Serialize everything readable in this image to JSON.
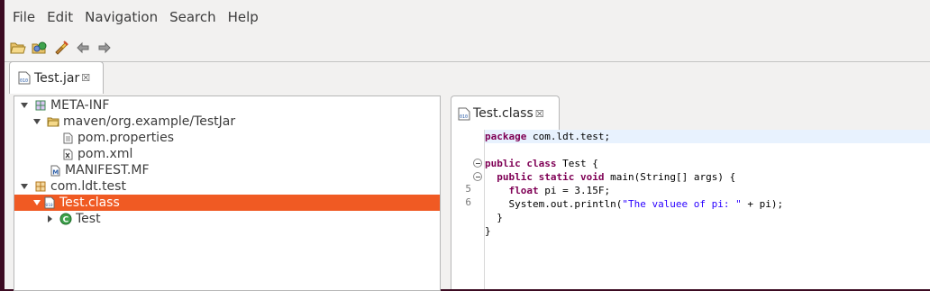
{
  "menu": [
    "File",
    "Edit",
    "Navigation",
    "Search",
    "Help"
  ],
  "toolbar": {
    "icons": [
      "open-file-icon",
      "open-type-icon",
      "run-icon",
      "back-arrow-icon",
      "forward-arrow-icon"
    ]
  },
  "jar_tab": {
    "label": "Test.jar",
    "close": "☒"
  },
  "tree": {
    "rows": [
      {
        "label": "META-INF",
        "icon": "package-icon",
        "expanded": true
      },
      {
        "label": "maven/org.example/TestJar",
        "icon": "folder-icon",
        "expanded": true
      },
      {
        "label": "pom.properties",
        "icon": "text-file-icon"
      },
      {
        "label": "pom.xml",
        "icon": "xml-file-icon"
      },
      {
        "label": "MANIFEST.MF",
        "icon": "manifest-icon"
      },
      {
        "label": "com.ldt.test",
        "icon": "package-icon",
        "expanded": true
      },
      {
        "label": "Test.class",
        "icon": "class-file-icon",
        "expanded": true,
        "selected": true
      },
      {
        "label": "Test",
        "icon": "class-icon",
        "expanded": false
      }
    ]
  },
  "editor": {
    "tab": {
      "label": "Test.class",
      "close": "☒"
    },
    "line_numbers": {
      "line5": "5",
      "line6": "6"
    },
    "code": {
      "l1_kw": "package",
      "l1_rest": " com.ldt.test;",
      "l3_kw1": "public",
      "l3_kw2": "class",
      "l3_rest": " Test {",
      "l4_indent": "  ",
      "l4_kw1": "public",
      "l4_kw2": "static",
      "l4_kw3": "void",
      "l4_rest": " main(String[] args) {",
      "l5_indent": "    ",
      "l5_kw": "float",
      "l5_rest": " pi = 3.15F;",
      "l6_pre": "    System.out.println(",
      "l6_str": "\"The valuee of pi: \"",
      "l6_post": " + pi);",
      "l7": "  }",
      "l8": "}"
    }
  },
  "colors": {
    "selection": "#f05a23",
    "keyword": "#7f0055",
    "string": "#2a00ff",
    "current_line": "#e8f2fe"
  }
}
